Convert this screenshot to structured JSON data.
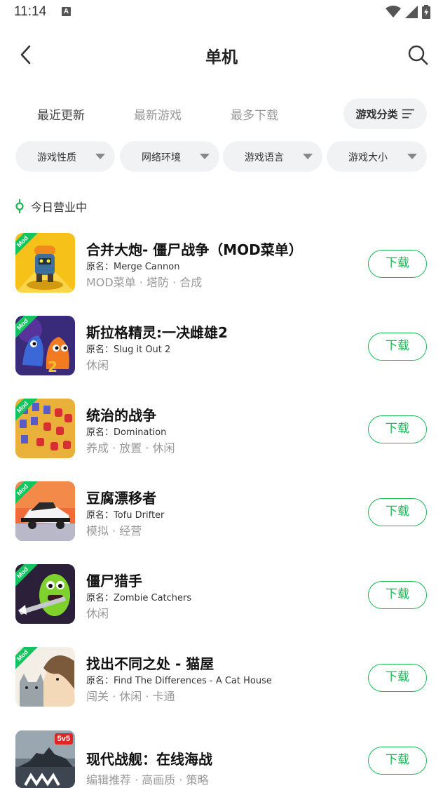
{
  "status_bar": {
    "time": "11:14",
    "a_badge": "A"
  },
  "header": {
    "title": "单机"
  },
  "tabs": [
    {
      "label": "最近更新",
      "active": true
    },
    {
      "label": "最新游戏",
      "active": false
    },
    {
      "label": "最多下载",
      "active": false
    }
  ],
  "category_button": {
    "label": "游戏分类"
  },
  "filters": [
    {
      "label": "游戏性质"
    },
    {
      "label": "网络环境"
    },
    {
      "label": "游戏语言"
    },
    {
      "label": "游戏大小"
    }
  ],
  "section": {
    "title": "今日营业中"
  },
  "download_label": "下载",
  "games": [
    {
      "title": "合并大炮- 僵尸战争（MOD菜单）",
      "original": "原名：Merge Cannon",
      "tags": "MOD菜单 · 塔防 · 合成",
      "badge": "Mod"
    },
    {
      "title": "斯拉格精灵:一决雌雄2",
      "original": "原名：Slug it Out 2",
      "tags": "休闲",
      "badge": "Mod"
    },
    {
      "title": "统治的战争",
      "original": "原名：Domination",
      "tags": "养成 · 放置 · 休闲",
      "badge": "Mod"
    },
    {
      "title": "豆腐漂移者",
      "original": "原名：Tofu Drifter",
      "tags": "模拟 · 经营",
      "badge": "Mod"
    },
    {
      "title": "僵尸猎手",
      "original": "原名：Zombie Catchers",
      "tags": "休闲",
      "badge": "Mod"
    },
    {
      "title": "找出不同之处 - 猫屋",
      "original": "原名：Find The Differences - A Cat House",
      "tags": "闯关 · 休闲 · 卡通",
      "badge": "Mod"
    },
    {
      "title": "现代战舰：在线海战",
      "original": "",
      "tags": "编辑推荐 · 高画质 · 策略",
      "badge": "5v5"
    }
  ],
  "colors": {
    "accent": "#19b955",
    "tab_highlight": "#4fdd7a",
    "chip_bg": "#f1f2f4",
    "mod_badge": "#13c45e"
  }
}
